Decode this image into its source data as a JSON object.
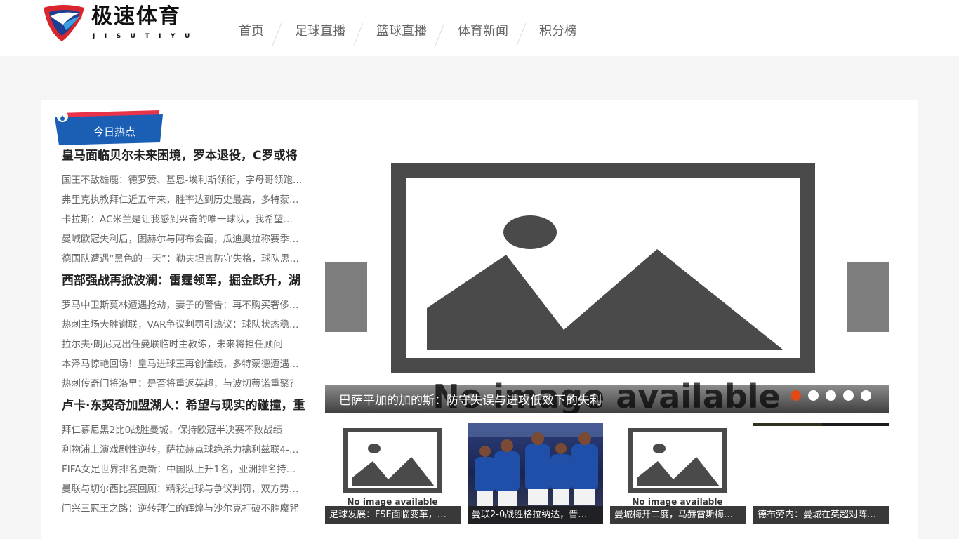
{
  "logo": {
    "title": "极速体育",
    "subtitle": "JISUTIYU"
  },
  "nav": [
    {
      "label": "首页"
    },
    {
      "label": "足球直播"
    },
    {
      "label": "篮球直播"
    },
    {
      "label": "体育新闻"
    },
    {
      "label": "积分榜"
    }
  ],
  "hot": {
    "label": "今日热点"
  },
  "news": [
    {
      "headline": "皇马面临贝尔未来困境，罗本退役，C罗或将",
      "items": [
        "国王不敌雄鹿：德罗赞、基恩-埃利斯领衔，字母哥领跑…",
        "弗里克执教拜仁近五年来，胜率达到历史最高，多特蒙…",
        "卡拉斯：AC米兰是让我感到兴奋的唯一球队，我希望…",
        "曼城欧冠失利后，图赫尔与阿布会面，瓜迪奥拉称赛季…",
        "德国队遭遇“黑色的一天”：勒夫坦言防守失格，球队思…"
      ]
    },
    {
      "headline": "西部强战再掀波澜：雷霆领军，掘金跃升，湖",
      "items": [
        "罗马中卫斯莫林遭遇抢劫，妻子的警告：再不购买奢侈…",
        "热刺主场大胜谢联，VAR争议判罚引热议：球队状态稳…",
        "拉尔夫·朗尼克出任曼联临时主教练，未来将担任顾问",
        "本泽马惊艳回场！皇马进球王再创佳绩，多特蒙德遭遇…",
        "热刺传奇门将洛里：是否将重返英超，与波切蒂诺重聚？"
      ]
    },
    {
      "headline": "卢卡·东契奇加盟湖人：希望与现实的碰撞，重",
      "items": [
        "拜仁慕尼黑2比0战胜曼城，保持欧冠半决赛不败战绩",
        "利物浦上演戏剧性逆转，萨拉赫点球绝杀力擒利兹联4-…",
        "FIFA女足世界排名更新：中国队上升1名，亚洲排名持…",
        "曼联与切尔西比赛回顾：精彩进球与争议判罚，双方势…",
        "门兴三冠王之路：逆转拜仁的辉煌与沙尔克打破不胜魔咒"
      ]
    }
  ],
  "slider": {
    "caption": "巴萨平加的加的斯：防守失误与进攻低效下的失利",
    "placeholder_text": "No image available",
    "dots": 5,
    "active_dot": 1
  },
  "thumbs": [
    {
      "caption": "足球发展：FSE面临变革，…",
      "placeholder_text": "No image available",
      "type": "placeholder"
    },
    {
      "caption": "曼联2-0战胜格拉纳达，晋…",
      "type": "photo"
    },
    {
      "caption": "曼城梅开二度，马赫雷斯梅…",
      "placeholder_text": "No image available",
      "type": "placeholder"
    },
    {
      "caption": "德布劳内：曼城在英超对阵…",
      "type": "dark"
    }
  ],
  "colors": {
    "accent_red": "#e24a16",
    "badge_blue": "#1a5fb4",
    "badge_red": "#e8334a",
    "rule": "#e2683c"
  }
}
